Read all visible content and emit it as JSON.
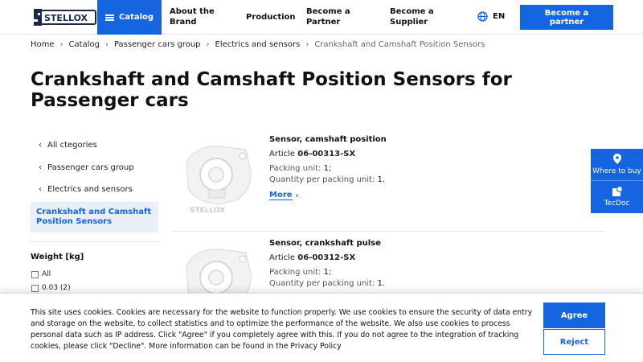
{
  "header": {
    "logo_text": "STELLOX",
    "catalog_label": "Catalog",
    "nav": [
      {
        "label": "About the Brand"
      },
      {
        "label": "Production"
      },
      {
        "label": "Become a Partner"
      },
      {
        "label": "Become a Supplier"
      }
    ],
    "language": "EN",
    "partner_button": "Become a partner"
  },
  "breadcrumb": [
    "Home",
    "Catalog",
    "Passenger cars group",
    "Electrics and sensors",
    "Crankshaft and Camshaft Position Sensors"
  ],
  "page_title": "Crankshaft and Camshaft Position Sensors for Passenger cars",
  "sidebar": {
    "links": [
      "All ctegories",
      "Passenger cars group",
      "Electrics and sensors"
    ],
    "active": "Crankshaft and Camshaft Position Sensors",
    "filter_title": "Weight [kg]",
    "filter_options": [
      "All",
      "0.03 (2)"
    ]
  },
  "products": [
    {
      "name": "Sensor, camshaft position",
      "article_label": "Article",
      "article": "06-00313-SX",
      "packing_label": "Packing unit:",
      "packing_value": "1;",
      "qty_label": "Quantity per packing unit:",
      "qty_value": "1.",
      "more_label": "More"
    },
    {
      "name": "Sensor, crankshaft pulse",
      "article_label": "Article",
      "article": "06-00312-SX",
      "packing_label": "Packing unit:",
      "packing_value": "1;",
      "qty_label": "Quantity per packing unit:",
      "qty_value": "1."
    }
  ],
  "float": {
    "where_to_buy": "Where to buy",
    "tecdoc": "TecDoc"
  },
  "cookie": {
    "text": "This site uses cookies. Cookies are necessary for the website to function properly. We use cookies to ensure the security of data entry and storage on the website, to collect statistics and to optimize the performance of the website. We also use cookies to process personal data such as IP address. Click \"Agree\" if you completely agree with this. If you do not agree to the integration of tracking cookies, please click \"Decline\". More information can be found in the Privacy Policy",
    "agree": "Agree",
    "reject": "Reject"
  },
  "colors": {
    "accent": "#1565e0",
    "active_bg": "#e9eff9"
  },
  "icons": [
    "menu-icon",
    "globe-icon",
    "chevron-right-icon",
    "chevron-left-icon",
    "location-pin-icon",
    "tecdoc-icon"
  ]
}
